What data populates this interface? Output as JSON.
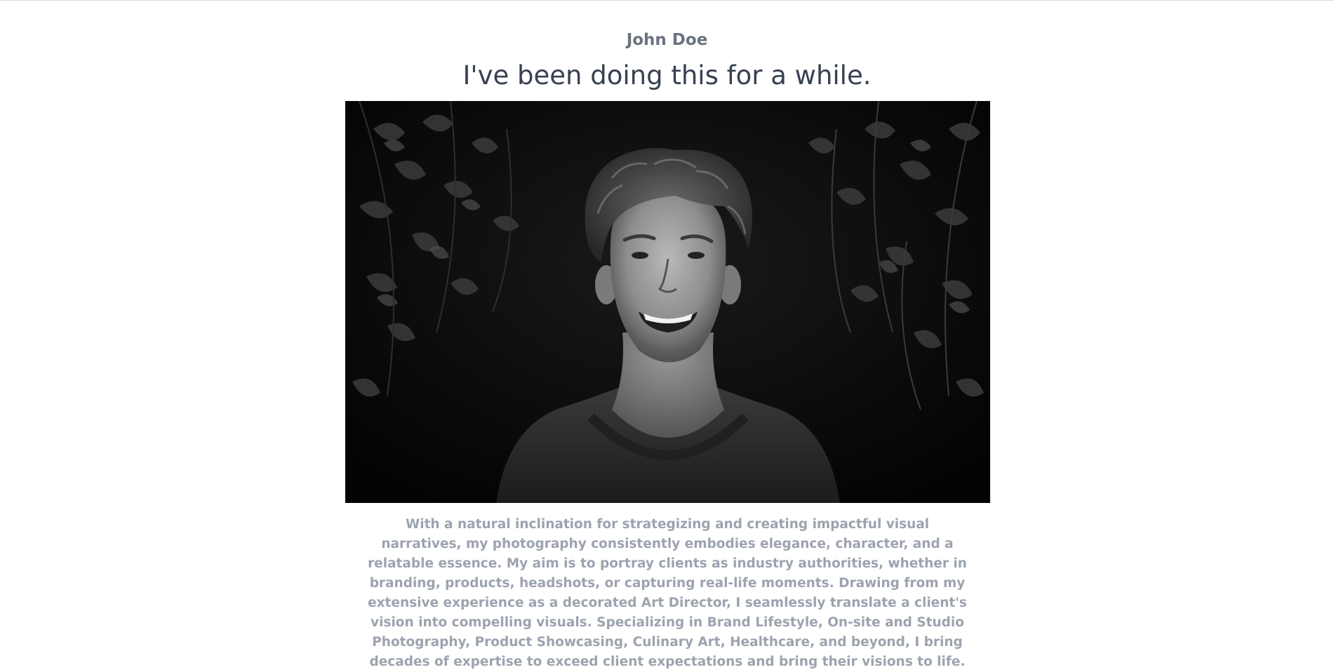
{
  "profile": {
    "name": "John Doe",
    "tagline": "I've been doing this for a while.",
    "photo_alt": "Black and white portrait of a smiling young man with curly hair in front of dark foliage",
    "bio": "With a natural inclination for strategizing and creating impactful visual narratives, my photography consistently embodies elegance, character, and a relatable essence. My aim is to portray clients as industry authorities, whether in branding, products, headshots, or capturing real-life moments. Drawing from my extensive experience as a decorated Art Director, I seamlessly translate a client's vision into compelling visuals. Specializing in Brand Lifestyle, On-site and Studio Photography, Product Showcasing, Culinary Art, Healthcare, and beyond, I bring decades of expertise to exceed client expectations and bring their visions to life."
  },
  "colors": {
    "name_text": "#6b7280",
    "tagline_text": "#374151",
    "bio_text": "#9ca3af",
    "background": "#ffffff"
  }
}
